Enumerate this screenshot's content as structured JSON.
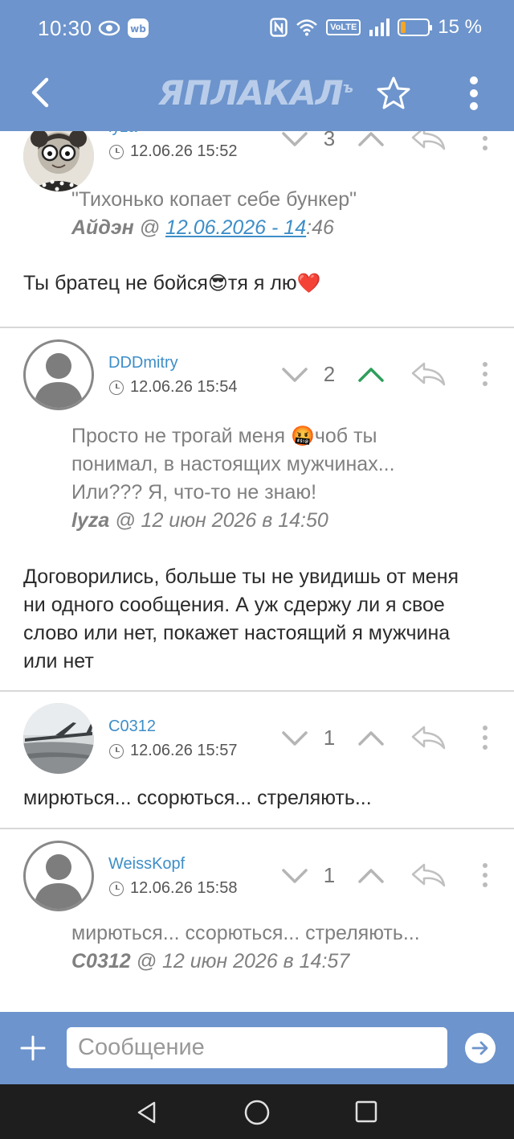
{
  "status_bar": {
    "time": "10:30",
    "battery_text": "15 %",
    "battery_level_percent": 15,
    "volte_label": "VoLTE",
    "icons": [
      "eye-icon",
      "wb-icon",
      "nfc-icon",
      "wifi-icon",
      "signal-icon",
      "battery-icon"
    ]
  },
  "header": {
    "logo_text": "ЯПЛАКАЛ",
    "logo_suffix": "ъ",
    "icons": [
      "back-arrow-icon",
      "star-icon",
      "more-vertical-icon"
    ]
  },
  "posts": [
    {
      "author": "lyza",
      "date": "12.06.26 15:52",
      "score": "3",
      "upvoted": false,
      "quote_text": "\"Тихонько копает себе бункер\"",
      "quote_author": "Айдэн",
      "quote_at": " @ ",
      "quote_link": "12.06.2026 - 14",
      "quote_time_rest": ":46",
      "message_part1": "Ты братец не бойся",
      "message_part2": "тя я лю",
      "emoji1": "😎",
      "emoji2": "❤️"
    },
    {
      "author": "DDDmitry",
      "date": "12.06.26 15:54",
      "score": "2",
      "upvoted": true,
      "quote_part1": "Просто не трогай меня ",
      "quote_emoji": "🤬",
      "quote_part2": "чоб ты понимал, в настоящих мужчинах... Или??? Я, что-то не знаю!",
      "quote_author": "lyza",
      "quote_meta_rest": " @ 12 июн 2026 в 14:50",
      "message": "Договорились, больше ты не увидишь от меня ни одного сообщения. А уж сдержу ли я свое слово или нет, покажет настоящий я мужчина или нет"
    },
    {
      "author": "C0312",
      "date": "12.06.26 15:57",
      "score": "1",
      "upvoted": false,
      "message": "мирються... ссорються... стреляють..."
    },
    {
      "author": "WeissKopf",
      "date": "12.06.26 15:58",
      "score": "1",
      "upvoted": false,
      "quote_text": "мирються... ссорються... стреляють...",
      "quote_author": "C0312",
      "quote_meta_rest": " @ 12 июн 2026 в 14:57"
    }
  ],
  "composer": {
    "placeholder": "Сообщение"
  },
  "colors": {
    "header_bg": "#6d94cc",
    "link": "#3e8ec7",
    "upvote_active": "#2e9e5b",
    "vote_inactive": "#b5b5b5"
  }
}
